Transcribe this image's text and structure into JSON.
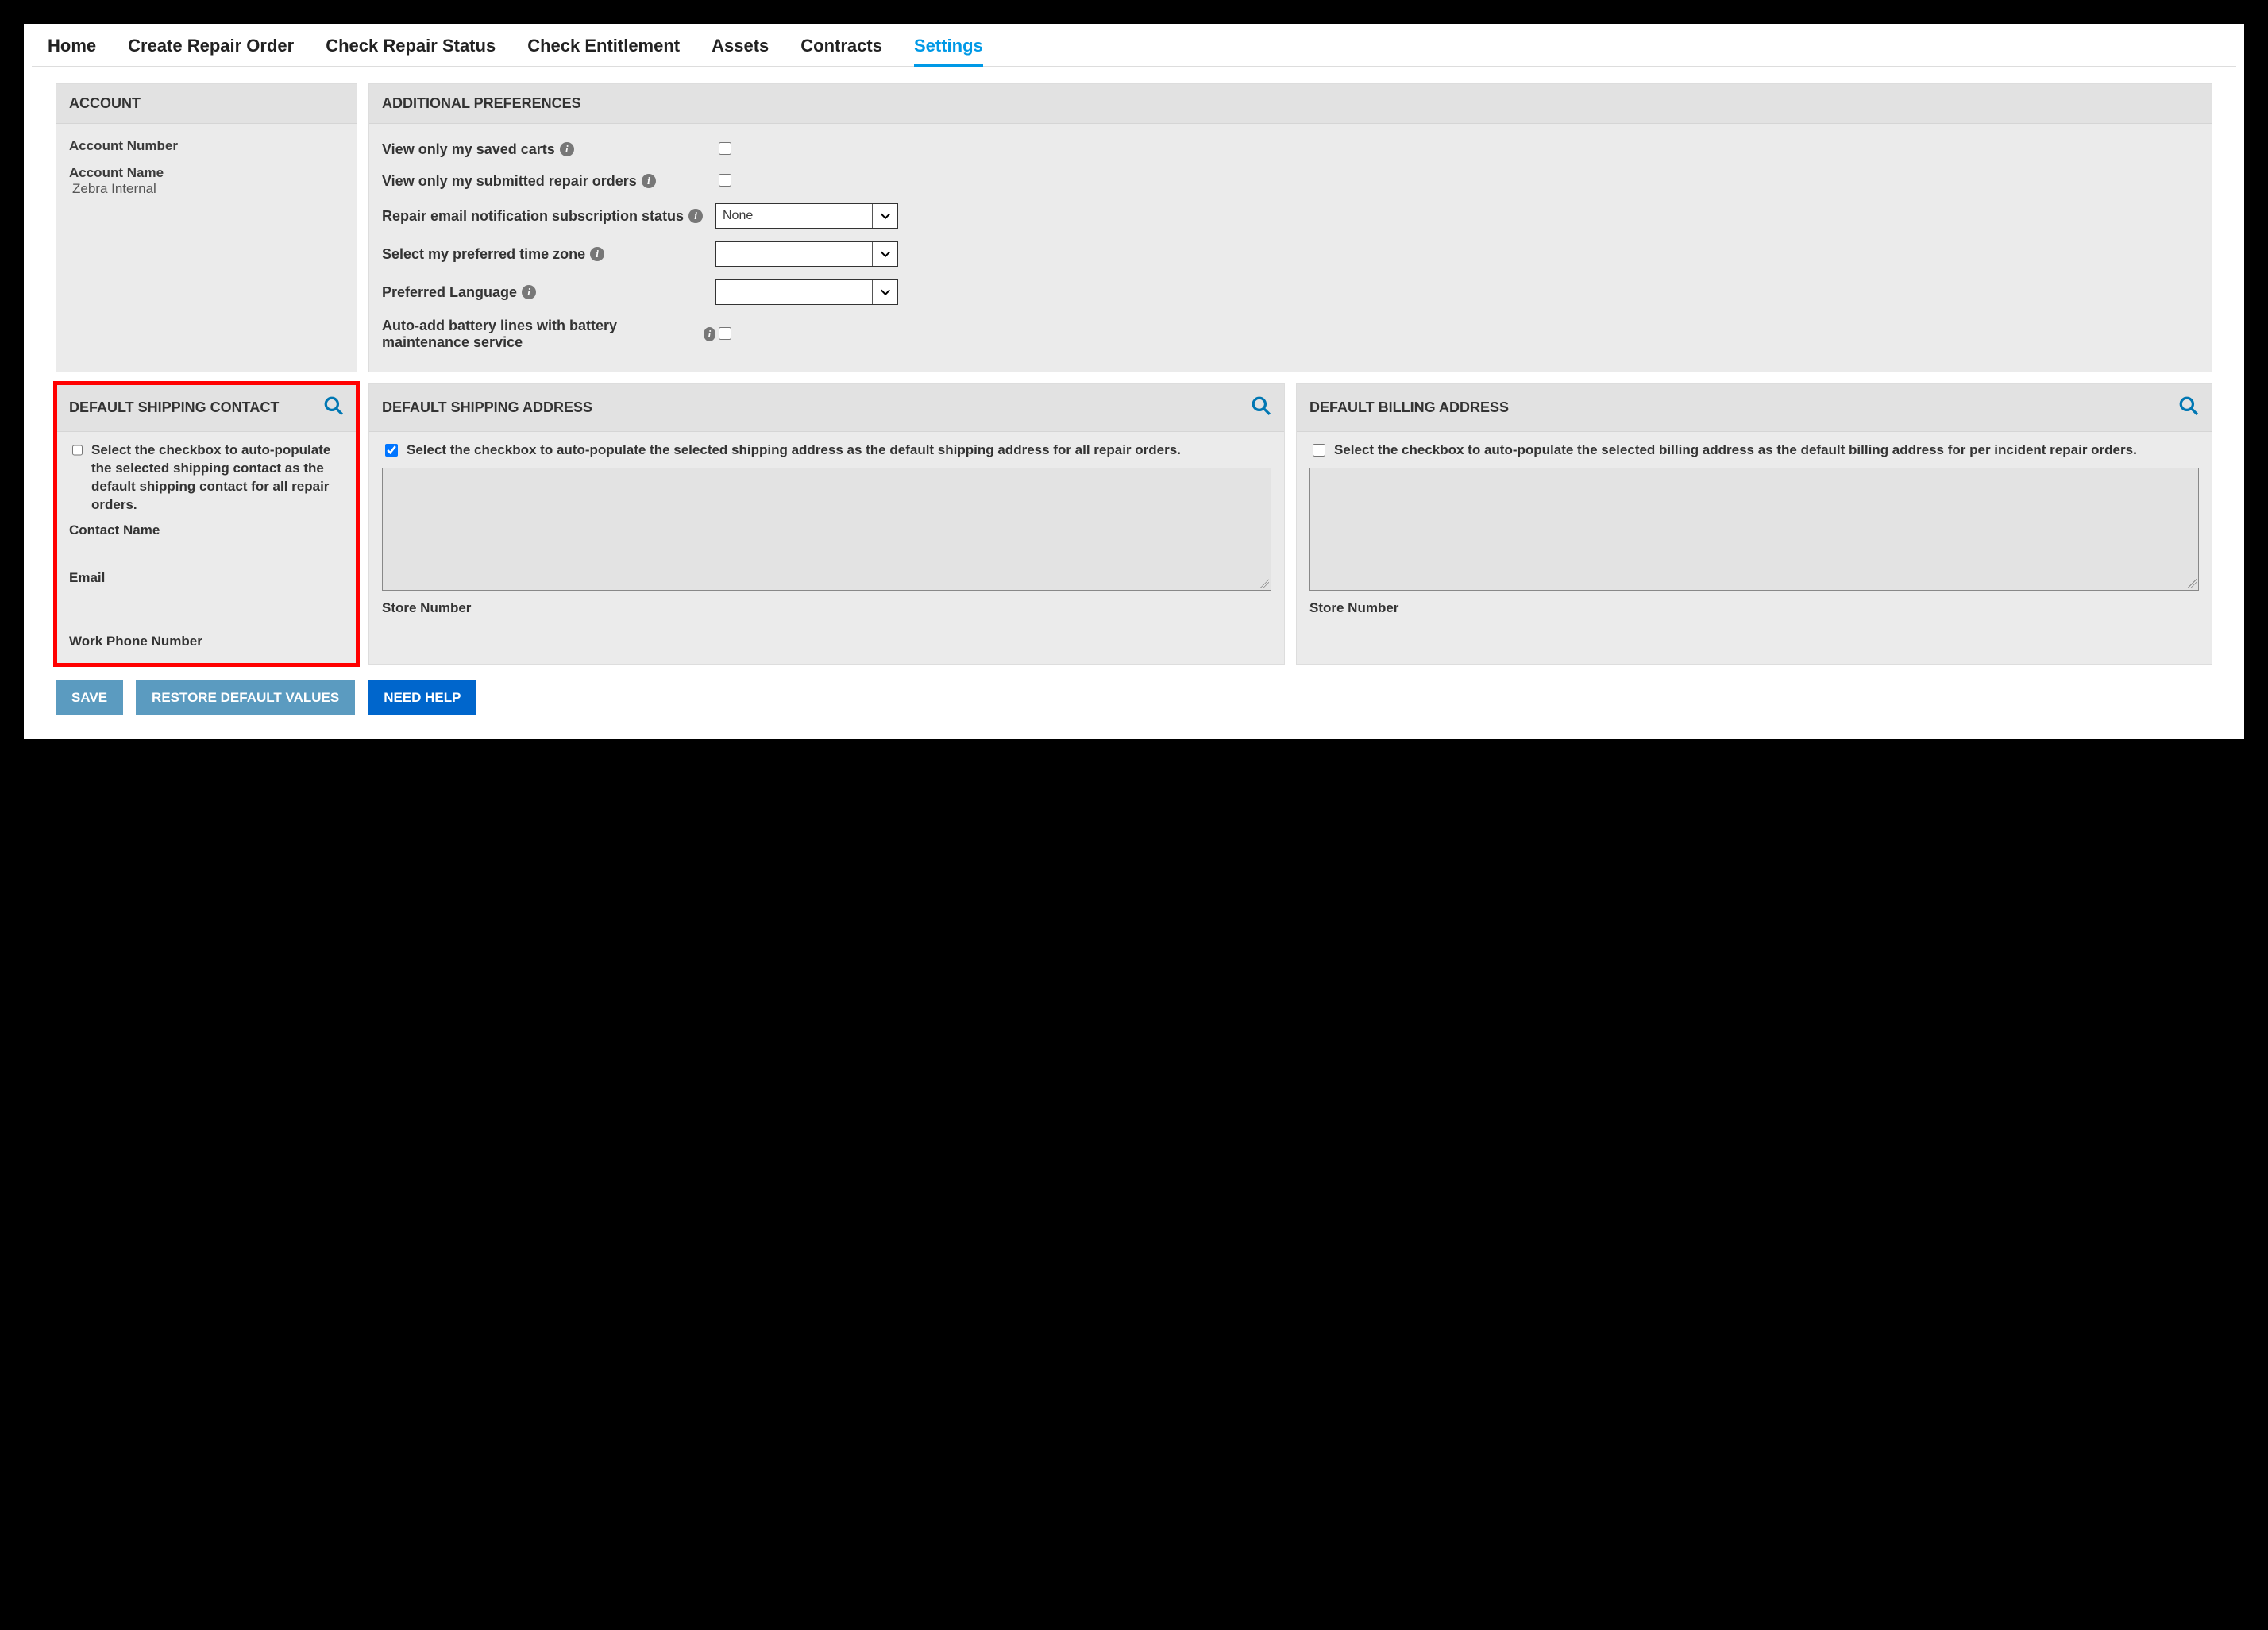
{
  "tabs": {
    "home": "Home",
    "create_repair": "Create Repair Order",
    "check_status": "Check Repair Status",
    "check_entitlement": "Check Entitlement",
    "assets": "Assets",
    "contracts": "Contracts",
    "settings": "Settings"
  },
  "account": {
    "header": "ACCOUNT",
    "number_label": "Account Number",
    "number_value": "",
    "name_label": "Account Name",
    "name_value": "Zebra Internal"
  },
  "prefs": {
    "header": "ADDITIONAL PREFERENCES",
    "saved_carts": "View only my saved carts",
    "submitted_orders": "View only my submitted repair orders",
    "email_sub": "Repair email notification subscription status",
    "email_sub_value": "None",
    "timezone": "Select my preferred time zone",
    "timezone_value": "",
    "language": "Preferred Language",
    "language_value": "",
    "battery": "Auto-add battery lines with battery maintenance service"
  },
  "ship_contact": {
    "header": "DEFAULT SHIPPING CONTACT",
    "desc": "Select the checkbox to auto-populate the selected shipping contact as the default shipping contact for all repair orders.",
    "contact_name": "Contact Name",
    "email": "Email",
    "phone": "Work Phone Number"
  },
  "ship_addr": {
    "header": "DEFAULT SHIPPING ADDRESS",
    "desc": "Select the checkbox to auto-populate the selected shipping address as the default shipping address for all repair orders.",
    "store": "Store Number"
  },
  "bill_addr": {
    "header": "DEFAULT BILLING ADDRESS",
    "desc": "Select the checkbox to auto-populate the selected billing address as the default billing address for per incident repair orders.",
    "store": "Store Number"
  },
  "buttons": {
    "save": "SAVE",
    "restore": "RESTORE DEFAULT VALUES",
    "help": "NEED HELP"
  }
}
